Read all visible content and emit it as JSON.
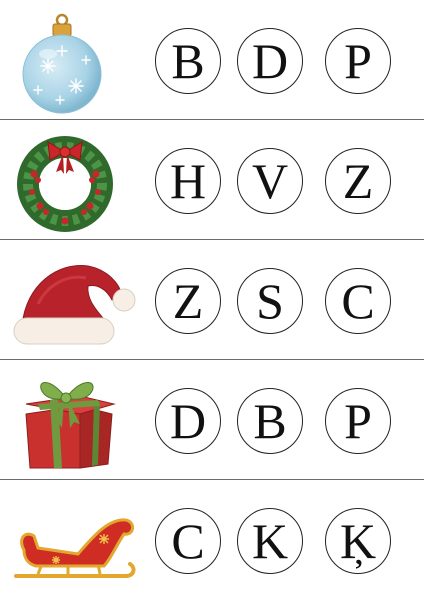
{
  "rows": [
    {
      "picture": "christmas-ornament-ball",
      "letters": [
        "B",
        "D",
        "P"
      ]
    },
    {
      "picture": "christmas-wreath",
      "letters": [
        "H",
        "V",
        "Z"
      ]
    },
    {
      "picture": "santa-hat",
      "letters": [
        "Z",
        "S",
        "C"
      ]
    },
    {
      "picture": "gift-box",
      "letters": [
        "D",
        "B",
        "P"
      ]
    },
    {
      "picture": "sleigh",
      "letters": [
        "C",
        "K",
        "Ķ"
      ]
    }
  ],
  "colors": {
    "divider": "#6a6a6a",
    "circle_border": "#222222",
    "letter": "#111111",
    "ornament": "#a9d3e6",
    "wreath_green": "#3f7d3a",
    "berry_red": "#c8262a",
    "hat_red": "#b8222a",
    "gift_red": "#c9312f",
    "ribbon_green": "#6f9a3f",
    "sleigh_red": "#cf2c23",
    "sleigh_gold": "#e2a72d"
  }
}
